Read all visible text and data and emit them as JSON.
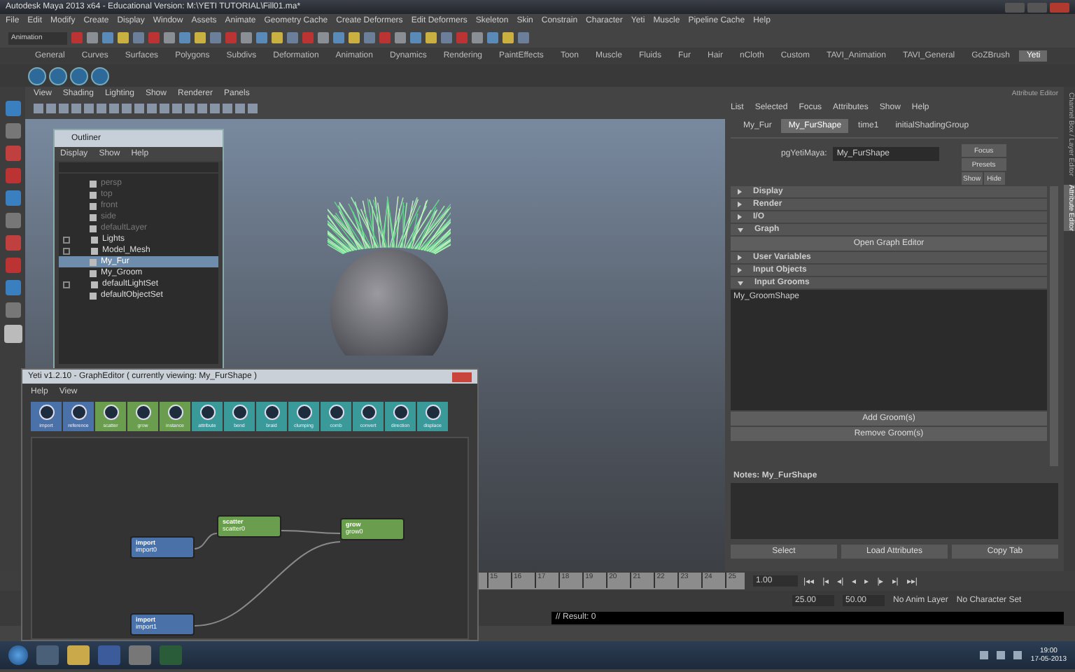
{
  "window": {
    "title": "Autodesk Maya 2013 x64 - Educational Version: M:\\YETI TUTORIAL\\Fill01.ma*"
  },
  "menu_bar": [
    "File",
    "Edit",
    "Modify",
    "Create",
    "Display",
    "Window",
    "Assets",
    "Animate",
    "Geometry Cache",
    "Create Deformers",
    "Edit Deformers",
    "Skeleton",
    "Skin",
    "Constrain",
    "Character",
    "Yeti",
    "Muscle",
    "Pipeline Cache",
    "Help"
  ],
  "mode_dropdown": "Animation",
  "shelf_tabs": [
    {
      "label": "General",
      "selected": false
    },
    {
      "label": "Curves",
      "selected": false
    },
    {
      "label": "Surfaces",
      "selected": false
    },
    {
      "label": "Polygons",
      "selected": false
    },
    {
      "label": "Subdivs",
      "selected": false
    },
    {
      "label": "Deformation",
      "selected": false
    },
    {
      "label": "Animation",
      "selected": false
    },
    {
      "label": "Dynamics",
      "selected": false
    },
    {
      "label": "Rendering",
      "selected": false
    },
    {
      "label": "PaintEffects",
      "selected": false
    },
    {
      "label": "Toon",
      "selected": false
    },
    {
      "label": "Muscle",
      "selected": false
    },
    {
      "label": "Fluids",
      "selected": false
    },
    {
      "label": "Fur",
      "selected": false
    },
    {
      "label": "Hair",
      "selected": false
    },
    {
      "label": "nCloth",
      "selected": false
    },
    {
      "label": "Custom",
      "selected": false
    },
    {
      "label": "TAVI_Animation",
      "selected": false
    },
    {
      "label": "TAVI_General",
      "selected": false
    },
    {
      "label": "GoZBrush",
      "selected": false
    },
    {
      "label": "Yeti",
      "selected": true
    }
  ],
  "panel_menu": [
    "View",
    "Shading",
    "Lighting",
    "Show",
    "Renderer",
    "Panels"
  ],
  "outliner": {
    "title": "Outliner",
    "menu": [
      "Display",
      "Show",
      "Help"
    ],
    "items": [
      {
        "label": "persp",
        "dimmed": true,
        "expandable": false,
        "selected": false
      },
      {
        "label": "top",
        "dimmed": true,
        "expandable": false,
        "selected": false
      },
      {
        "label": "front",
        "dimmed": true,
        "expandable": false,
        "selected": false
      },
      {
        "label": "side",
        "dimmed": true,
        "expandable": false,
        "selected": false
      },
      {
        "label": "defaultLayer",
        "dimmed": true,
        "expandable": false,
        "selected": false
      },
      {
        "label": "Lights",
        "dimmed": false,
        "expandable": true,
        "selected": false
      },
      {
        "label": "Model_Mesh",
        "dimmed": false,
        "expandable": true,
        "selected": false
      },
      {
        "label": "My_Fur",
        "dimmed": false,
        "expandable": false,
        "selected": true
      },
      {
        "label": "My_Groom",
        "dimmed": false,
        "expandable": false,
        "selected": false
      },
      {
        "label": "defaultLightSet",
        "dimmed": false,
        "expandable": true,
        "selected": false
      },
      {
        "label": "defaultObjectSet",
        "dimmed": false,
        "expandable": false,
        "selected": false
      }
    ]
  },
  "graph_editor": {
    "title": "Yeti v1.2.10 - GraphEditor ( currently viewing: My_FurShape )",
    "menu": [
      "Help",
      "View"
    ],
    "tools": [
      {
        "label": "import",
        "color": "#4a72a8"
      },
      {
        "label": "reference",
        "color": "#4a72a8"
      },
      {
        "label": "scatter",
        "color": "#6a9e4e"
      },
      {
        "label": "grow",
        "color": "#6a9e4e"
      },
      {
        "label": "instance",
        "color": "#6a9e4e"
      },
      {
        "label": "attribute",
        "color": "#3a9a9a"
      },
      {
        "label": "bend",
        "color": "#3a9a9a"
      },
      {
        "label": "braid",
        "color": "#3a9a9a"
      },
      {
        "label": "clumping",
        "color": "#3a9a9a"
      },
      {
        "label": "comb",
        "color": "#3a9a9a"
      },
      {
        "label": "convert",
        "color": "#3a9a9a"
      },
      {
        "label": "direction",
        "color": "#3a9a9a"
      },
      {
        "label": "displace",
        "color": "#3a9a9a"
      }
    ],
    "nodes": [
      {
        "type": "import",
        "name": "import0",
        "color": "#4a72a8"
      },
      {
        "type": "scatter",
        "name": "scatter0",
        "color": "#6a9e4e"
      },
      {
        "type": "grow",
        "name": "grow0",
        "color": "#6a9e4e"
      },
      {
        "type": "import",
        "name": "import1",
        "color": "#4a72a8"
      }
    ]
  },
  "attribute_editor": {
    "title": "Attribute Editor",
    "menu": [
      "List",
      "Selected",
      "Focus",
      "Attributes",
      "Show",
      "Help"
    ],
    "tabs": [
      {
        "label": "My_Fur",
        "selected": false
      },
      {
        "label": "My_FurShape",
        "selected": true
      },
      {
        "label": "time1",
        "selected": false
      },
      {
        "label": "initialShadingGroup",
        "selected": false
      }
    ],
    "field": {
      "label": "pgYetiMaya:",
      "value": "My_FurShape"
    },
    "side_buttons": [
      "Focus",
      "Presets",
      "Show",
      "Hide"
    ],
    "sections": [
      {
        "kind": "section",
        "label": "Display",
        "expanded": false
      },
      {
        "kind": "section",
        "label": "Render",
        "expanded": false
      },
      {
        "kind": "section",
        "label": "I/O",
        "expanded": false
      },
      {
        "kind": "section",
        "label": "Graph",
        "expanded": true
      },
      {
        "kind": "button",
        "label": "Open Graph Editor"
      },
      {
        "kind": "section",
        "label": "User Variables",
        "expanded": false
      },
      {
        "kind": "section",
        "label": "Input Objects",
        "expanded": false
      },
      {
        "kind": "section",
        "label": "Input Grooms",
        "expanded": true
      },
      {
        "kind": "list",
        "items": [
          "My_GroomShape"
        ]
      },
      {
        "kind": "button",
        "label": "Add Groom(s)"
      },
      {
        "kind": "button",
        "label": "Remove Groom(s)"
      }
    ],
    "notes_label": "Notes:  My_FurShape",
    "buttons": [
      "Select",
      "Load Attributes",
      "Copy Tab"
    ]
  },
  "side_tabs": [
    {
      "label": "Channel Box / Layer Editor",
      "selected": false
    },
    {
      "label": "Attribute Editor",
      "selected": true
    }
  ],
  "timeline": {
    "ticks": [
      "15",
      "16",
      "17",
      "18",
      "19",
      "20",
      "21",
      "22",
      "23",
      "24",
      "25"
    ],
    "current": "1.00",
    "transport": [
      "|◂◂",
      "|◂",
      "◂|",
      "◂",
      "▸",
      "|▸",
      "▸|",
      "▸▸|"
    ]
  },
  "range": {
    "start": "25.00",
    "end": "50.00",
    "anim_layer": "No Anim Layer",
    "character_set": "No Character Set"
  },
  "command_line": {
    "result": "// Result: 0"
  },
  "clock": {
    "time": "19:00",
    "date": "17-05-2013"
  }
}
